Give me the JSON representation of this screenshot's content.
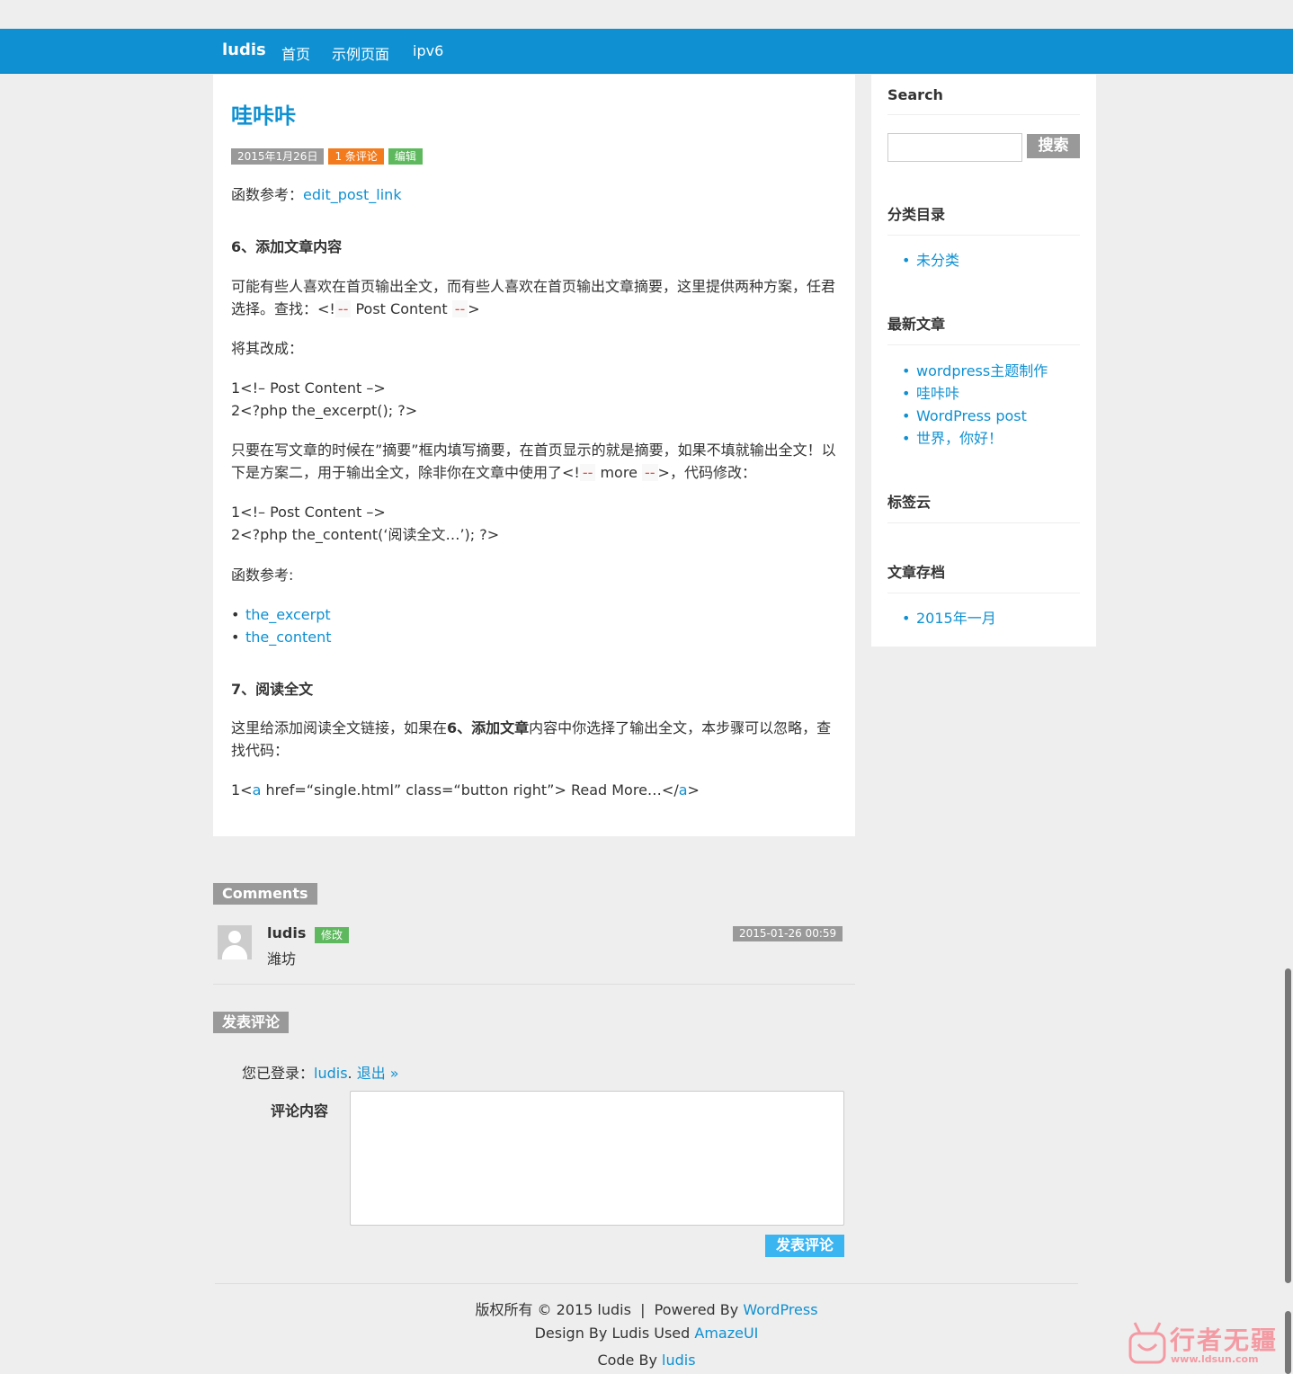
{
  "nav": {
    "brand": "ludis",
    "items": [
      "首页",
      "示例页面",
      "ipv6"
    ]
  },
  "post": {
    "title": "哇咔咔",
    "date": "2015年1月26日",
    "comments": "1 条评论",
    "edit": "编辑",
    "ref_label": "函数参考：",
    "ref_link": "edit_post_link",
    "h6": "6、添加文章内容",
    "p1a": "可能有些人喜欢在首页输出全文，而有些人喜欢在首页输出文章摘要，这里提供两种方案，任君",
    "p1b_pre": "选择。查找：<!",
    "p1b_dash": "--",
    "p1b_mid": " Post Content ",
    "p1b_end": ">",
    "p2": "将其改成：",
    "code1_l1": "1<!– Post Content –>",
    "code1_l2": "2<?php the_excerpt(); ?>",
    "p3a": "只要在写文章的时候在”摘要”框内填写摘要，在首页显示的就是摘要，如果不填就输出全文！以",
    "p3b_pre": "下是方案二，用于输出全文，除非你在文章中使用了<!",
    "p3b_mid": " more ",
    "p3b_end": ">，代码修改：",
    "code2_l1": "1<!– Post Content –>",
    "code2_l2": "2<?php the_content(‘阅读全文…’); ?>",
    "p4": "函数参考:",
    "links": [
      "the_excerpt",
      "the_content"
    ],
    "h7": "7、阅读全文",
    "p5a_pre": "这里给添加阅读全文链接，如果在",
    "p5a_bold": "6、添加文章",
    "p5a_post": "内容中你选择了输出全文，本步骤可以忽略，查",
    "p5b": "找代码：",
    "code3_pre": "1<",
    "code3_a1": "a",
    "code3_mid": " href=“single.html” class=“button right”> Read More…</",
    "code3_a2": "a",
    "code3_end": ">"
  },
  "sidebar": {
    "search_title": "Search",
    "search_button": "搜索",
    "categories_title": "分类目录",
    "categories": [
      "未分类"
    ],
    "recent_title": "最新文章",
    "recent": [
      "wordpress主题制作",
      "哇咔咔",
      "WordPress post",
      "世界，你好！"
    ],
    "tags_title": "标签云",
    "archive_title": "文章存档",
    "archives": [
      "2015年一月"
    ]
  },
  "comments": {
    "title": "Comments",
    "author": "ludis",
    "edit": "修改",
    "date": "2015-01-26 00:59",
    "text": "潍坊"
  },
  "reply": {
    "title": "发表评论",
    "logged_in_prefix": "您已登录：",
    "user": "ludis",
    "sep": ". ",
    "logout": "退出 »",
    "label": "评论内容",
    "submit": "发表评论"
  },
  "footer": {
    "line1_pre": "版权所有 © 2015 ludis  |  Powered By ",
    "line1_link": "WordPress",
    "line2_pre": "Design By Ludis Used ",
    "line2_link": "AmazeUI",
    "line3_pre": "Code By ",
    "line3_link": "ludis"
  },
  "watermark": {
    "text": "行者无疆",
    "url": "www.ldsun.com"
  },
  "colors": {
    "primary": "#0e90d2",
    "badge_gray": "#999999",
    "badge_orange": "#f37b1d",
    "badge_green": "#5eb95e",
    "submit": "#3bb4f2"
  }
}
